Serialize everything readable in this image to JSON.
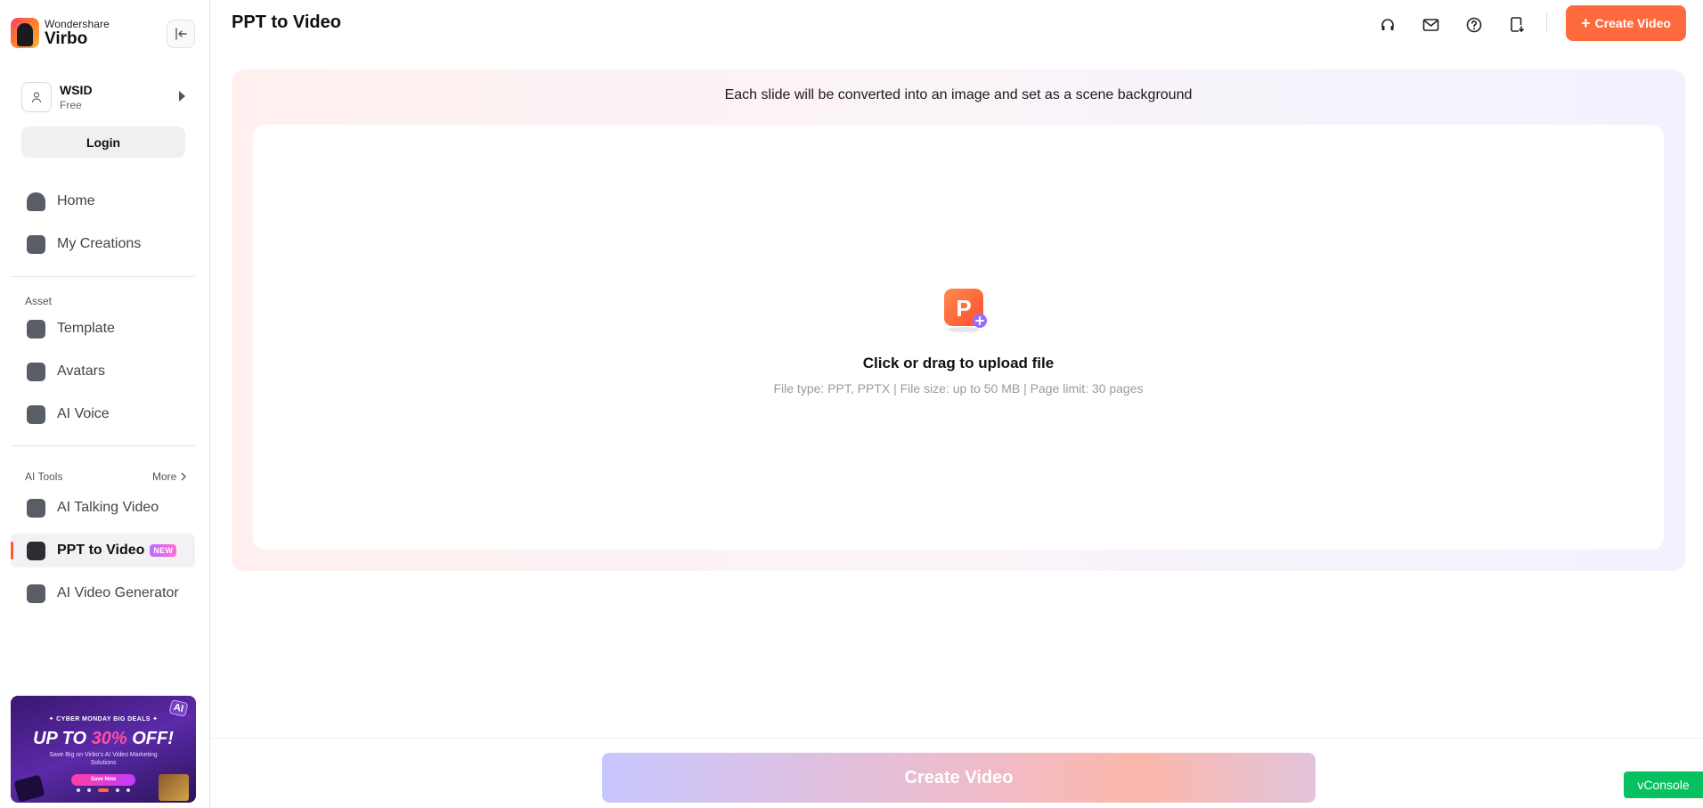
{
  "brand": {
    "top": "Wondershare",
    "name": "Virbo"
  },
  "account": {
    "name": "WSID",
    "plan": "Free",
    "login_label": "Login"
  },
  "nav": {
    "main": [
      {
        "label": "Home",
        "icon": "home-icon"
      },
      {
        "label": "My Creations",
        "icon": "creations-icon"
      }
    ],
    "asset_label": "Asset",
    "asset": [
      {
        "label": "Template",
        "icon": "template-icon"
      },
      {
        "label": "Avatars",
        "icon": "avatar-icon"
      },
      {
        "label": "AI Voice",
        "icon": "voice-icon"
      }
    ],
    "tools_label": "AI Tools",
    "more_label": "More",
    "tools": [
      {
        "label": "AI Talking Video",
        "icon": "talking-video-icon"
      },
      {
        "label": "PPT to Video",
        "icon": "ppt-icon",
        "badge": "NEW",
        "active": true
      },
      {
        "label": "AI Video Generator",
        "icon": "video-generator-icon"
      }
    ]
  },
  "promo": {
    "deal": "✦ CYBER MONDAY BIG DEALS ✦",
    "title_prefix": "UP TO ",
    "title_highlight": "30%",
    "title_suffix": " OFF!",
    "subtitle": "Save Big on Virbo's AI Video Marketing Solutions",
    "button": "Save Now",
    "ai_tag": "AI"
  },
  "header": {
    "title": "PPT to Video",
    "icons": [
      "headset-icon",
      "mail-icon",
      "help-icon",
      "download-icon"
    ],
    "create_label": "Create Video"
  },
  "upload": {
    "note": "Each slide will be converted into an image and set as a scene background",
    "title": "Click or drag to upload file",
    "hint": "File type: PPT, PPTX | File size: up to 50 MB | Page limit: 30 pages"
  },
  "footer": {
    "create_label": "Create Video",
    "vconsole_label": "vConsole"
  },
  "colors": {
    "accent": "#ff6a3d",
    "vconsole": "#07c160"
  }
}
